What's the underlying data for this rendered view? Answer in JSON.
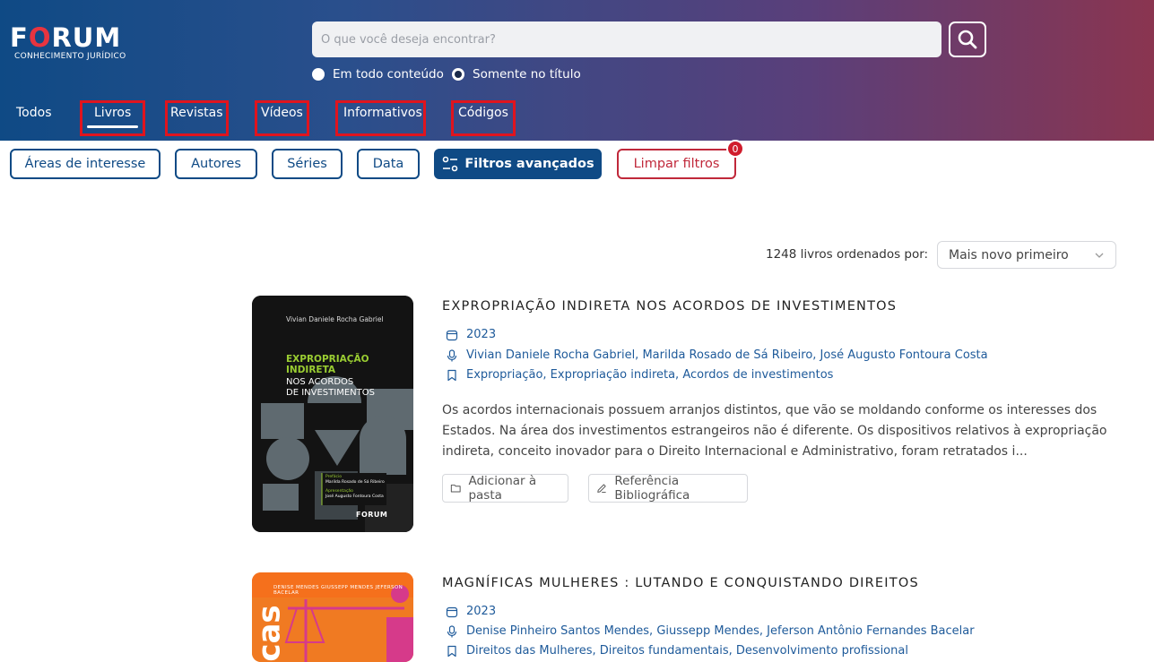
{
  "colors": {
    "brand_blue": "#0f4a85",
    "brand_red": "#e0141e",
    "clear_red": "#c0283a",
    "link_blue": "#1e5a9a"
  },
  "logo": {
    "name": "FORUM",
    "subtitle": "CONHECIMENTO JURÍDICO"
  },
  "search": {
    "placeholder": "O que você deseja encontrar?",
    "button_icon": "search-icon"
  },
  "search_scope": {
    "options": [
      {
        "label": "Em todo conteúdo",
        "selected": false
      },
      {
        "label": "Somente no título",
        "selected": true
      }
    ]
  },
  "tabs": [
    {
      "label": "Todos",
      "active": false
    },
    {
      "label": "Livros",
      "active": true
    },
    {
      "label": "Revistas",
      "active": false
    },
    {
      "label": "Vídeos",
      "active": false
    },
    {
      "label": "Informativos",
      "active": false
    },
    {
      "label": "Códigos",
      "active": false
    }
  ],
  "filters": {
    "areas": "Áreas de interesse",
    "authors": "Autores",
    "series": "Séries",
    "date": "Data",
    "advanced": "Filtros avançados",
    "advanced_icon": "filter-sliders-icon",
    "clear": "Limpar filtros",
    "clear_badge": "0"
  },
  "results": {
    "count_text": "1248 livros ordenados por:",
    "sort_value": "Mais novo primeiro"
  },
  "books": [
    {
      "title": "EXPROPRIAÇÃO INDIRETA NOS ACORDOS DE INVESTIMENTOS",
      "year": "2023",
      "authors": "Vivian Daniele Rocha Gabriel, Marilda Rosado de Sá Ribeiro, José Augusto Fontoura Costa",
      "subjects": "Expropriação, Expropriação indireta, Acordos de investimentos",
      "description": "Os acordos internacionais possuem arranjos distintos, que vão se moldando conforme os interesses dos Estados. Na área dos investimentos estrangeiros não é diferente. Os dispositivos relativos à expropriação indireta, conceito inovador para o Direito Internacional e Administrativo, foram retratados i...",
      "add_folder": "Adicionar à pasta",
      "bibliographic_ref": "Referência Bibliográfica",
      "cover": {
        "author": "Vivian Daniele Rocha Gabriel",
        "title_line1": "EXPROPRIAÇÃO",
        "title_line2": "INDIRETA",
        "title_line3": "NOS ACORDOS",
        "title_line4": "DE INVESTIMENTOS",
        "preface_label": "Prefácio",
        "preface_name": "Marilda Rosado de Sá Ribeiro",
        "presentation_label": "Apresentação",
        "presentation_name": "José Augusto Fontoura Costa",
        "publisher": "FORUM"
      }
    },
    {
      "title": "MAGNÍFICAS MULHERES : LUTANDO E CONQUISTANDO DIREITOS",
      "year": "2023",
      "authors": "Denise Pinheiro Santos Mendes, Giussepp Mendes, Jeferson Antônio Fernandes Bacelar",
      "subjects": "Direitos das Mulheres, Direitos fundamentais, Desenvolvimento profissional",
      "cover": {
        "authors_line": "DENISE MENDES  GIUSSEPP MENDES  JEFERSON BACELAR",
        "word": "cas"
      }
    }
  ]
}
